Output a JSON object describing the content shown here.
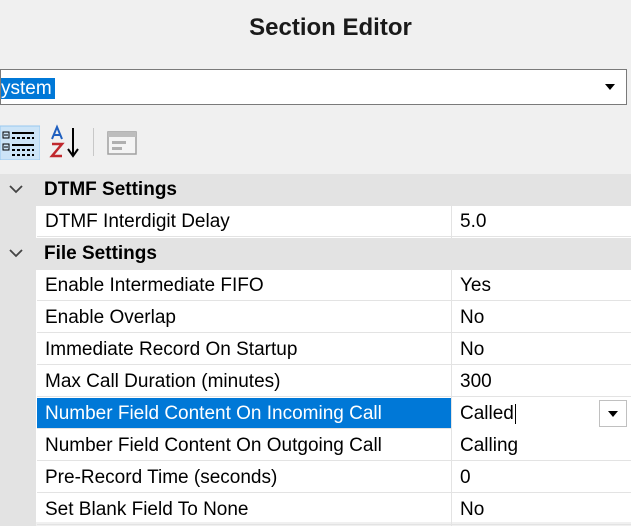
{
  "window": {
    "title": "Section Editor"
  },
  "object_selector": {
    "value": "ystem"
  },
  "toolbar": {
    "categorized_icon": "categorized-view-icon",
    "alphabetical_icon": "alphabetical-sort-icon",
    "property_pages_icon": "property-pages-icon"
  },
  "grid": {
    "categories": [
      {
        "label": "DTMF Settings",
        "properties": [
          {
            "name": "DTMF Interdigit Delay",
            "value": "5.0"
          }
        ]
      },
      {
        "label": "File Settings",
        "properties": [
          {
            "name": "Enable Intermediate FIFO",
            "value": "Yes"
          },
          {
            "name": "Enable Overlap",
            "value": "No"
          },
          {
            "name": "Immediate Record On Startup",
            "value": "No"
          },
          {
            "name": "Max Call Duration (minutes)",
            "value": "300"
          },
          {
            "name": "Number Field Content On Incoming Call",
            "value": "Called"
          },
          {
            "name": "Number Field Content On Outgoing Call",
            "value": "Calling"
          },
          {
            "name": "Pre-Record Time (seconds)",
            "value": "0"
          },
          {
            "name": "Set Blank Field To None",
            "value": "No"
          }
        ]
      }
    ]
  },
  "colors": {
    "selection": "#0078d7",
    "category_band": "#e3e3e3",
    "window_bg": "#f0f0f0"
  }
}
